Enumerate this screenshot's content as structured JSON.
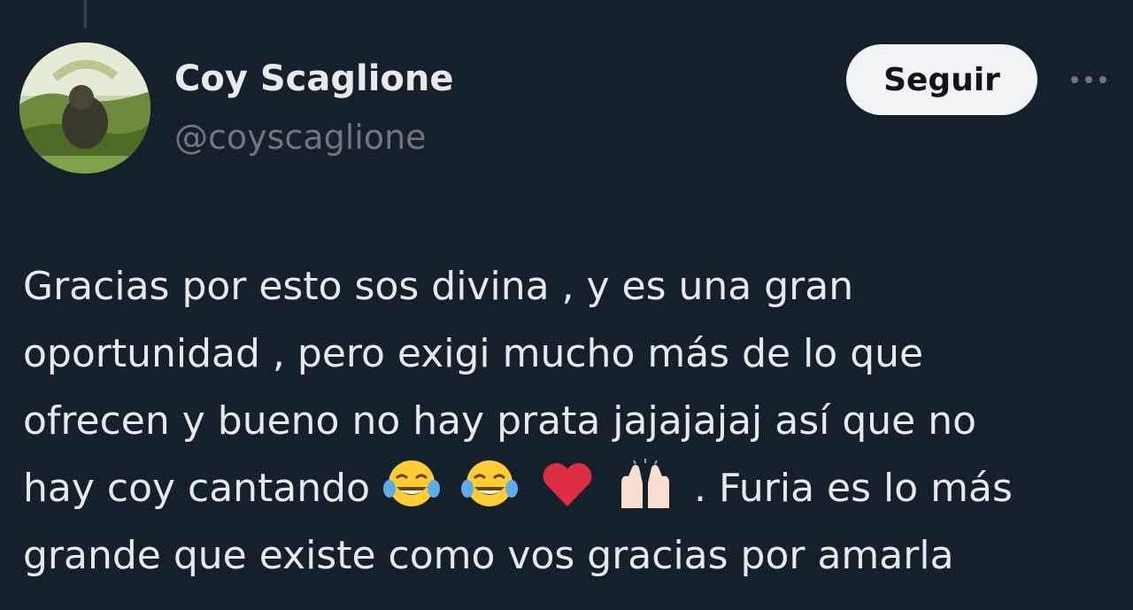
{
  "author": {
    "display_name": "Coy Scaglione",
    "handle": "@coyscaglione"
  },
  "actions": {
    "follow_label": "Seguir",
    "more_icon": "more-horizontal-icon"
  },
  "tweet": {
    "lines": [
      "Gracias por esto sos divina , y es una gran",
      "oportunidad , pero exigi mucho más de lo que",
      "ofrecen y bueno no hay prata jajajajaj así que no"
    ],
    "line4_before": "hay coy cantando",
    "line4_after": ". Furia es lo más",
    "line5": "grande que existe como vos gracias por amarla",
    "emojis": [
      "face-with-tears-of-joy-icon",
      "face-with-tears-of-joy-icon",
      "red-heart-icon",
      "raising-hands-icon"
    ]
  },
  "colors": {
    "background": "#15202b",
    "text_primary": "#e7e9ea",
    "text_secondary": "#71767b",
    "button_bg": "#eff3f4",
    "heart": "#e0245e"
  }
}
